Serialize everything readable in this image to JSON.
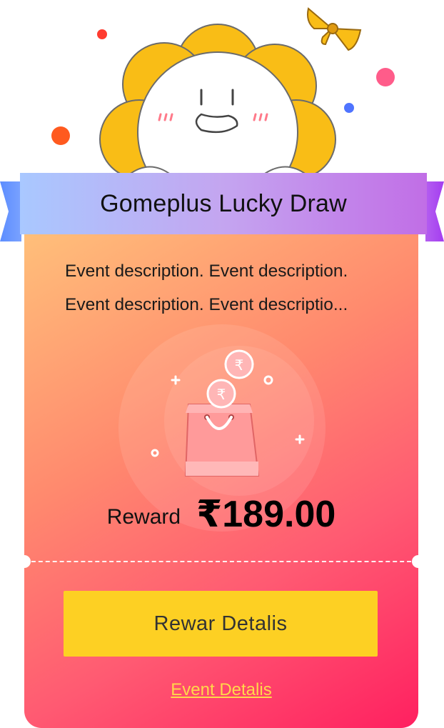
{
  "header": {
    "title": "Gomeplus Lucky Draw"
  },
  "event": {
    "description_line1": "Event description. Event description.",
    "description_line2": "Event description. Event descriptio..."
  },
  "reward": {
    "label": "Reward",
    "amount": "₹189.00"
  },
  "coins": {
    "symbol": "₹"
  },
  "actions": {
    "reward_details_label": "Rewar Detalis",
    "event_details_label": "Event Detalis"
  },
  "colors": {
    "card_top": "#ffc07a",
    "card_bottom": "#ff2060",
    "button": "#fdd023",
    "link": "#ffd84a",
    "ribbon_left": "#a9c8ff",
    "ribbon_right": "#c16ee6",
    "flower_petal": "#f9bd16"
  },
  "icons": [
    "flower-mascot-icon",
    "bow-icon",
    "shopping-bag-icon",
    "rupee-coin-icon",
    "sparkle-icon"
  ]
}
